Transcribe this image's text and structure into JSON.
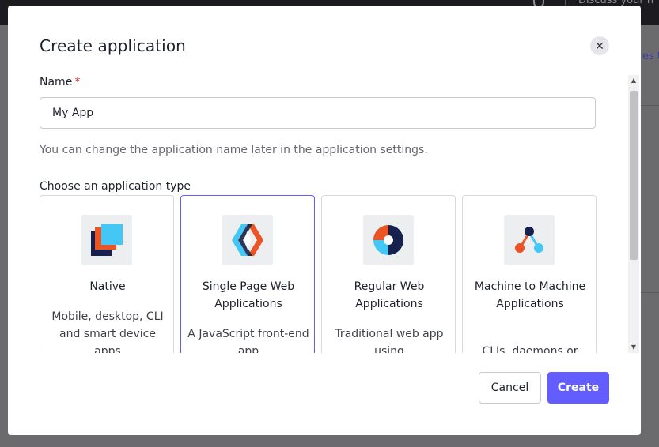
{
  "background": {
    "header_text": "Discuss your n",
    "link_text": "es t"
  },
  "modal": {
    "title": "Create application",
    "close_glyph": "✕",
    "name_label": "Name",
    "required_mark": "*",
    "name_value": "My App",
    "name_help": "You can change the application name later in the application settings.",
    "type_label": "Choose an application type",
    "types": [
      {
        "title": "Native",
        "description": "Mobile, desktop, CLI and smart device apps",
        "icon": "native-app-icon",
        "selected": false
      },
      {
        "title": "Single Page Web Applications",
        "description": "A JavaScript front-end app",
        "icon": "spa-icon",
        "selected": true
      },
      {
        "title": "Regular Web Applications",
        "description": "Traditional web app using",
        "icon": "regular-web-app-icon",
        "selected": false
      },
      {
        "title": "Machine to Machine Applications",
        "description": "CLIs, daemons or",
        "icon": "m2m-app-icon",
        "selected": false
      }
    ],
    "cancel_label": "Cancel",
    "create_label": "Create"
  },
  "colors": {
    "accent": "#635dff",
    "required": "#d0302f",
    "icon_orange": "#eb5424",
    "icon_blue": "#44c7f4",
    "icon_navy": "#16214d"
  }
}
